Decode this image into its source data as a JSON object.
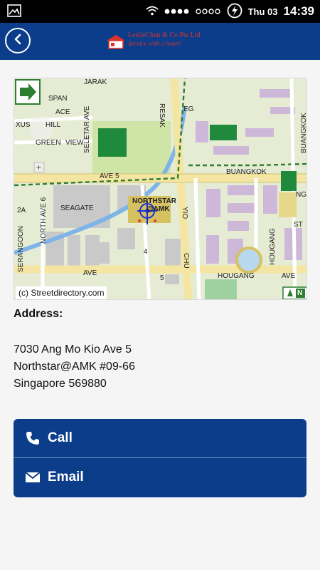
{
  "status_bar": {
    "date": "Thu 03",
    "time": "14:39"
  },
  "header": {
    "brand": "LeslieChan & Co Pte Ltd",
    "tagline": "Service with a heart!"
  },
  "map": {
    "credit": "(c) Streetdirectory.com",
    "labels": {
      "jarak": "JARAK",
      "resak": "RESAK",
      "span": "SPAN",
      "ace": "ACE",
      "xus": "XUS",
      "hill": "HILL",
      "green": "GREEN",
      "view": "VIEW",
      "seletar_ave": "SELETAR AVE",
      "ave5_left": "AVE 5",
      "buangkok_h": "BUANGKOK",
      "buangkok_v": "BUANGKOK",
      "seagate": "SEAGATE",
      "north_ave6": "NORTH AVE 6",
      "serangoon": "SERANGOON",
      "northstar": "NORTHSTAR",
      "amk": "@AMK",
      "two_a": "2A",
      "yio": "YIO",
      "chu": "CHU",
      "four": "4",
      "five": "5",
      "ave_bottom": "AVE",
      "hougang_h": "HOUGANG",
      "hougang_v": "HOUGANG",
      "ave_right": "AVE",
      "st": "ST",
      "n": "N",
      "ng": "NG",
      "eg": "EG"
    }
  },
  "address": {
    "label": "Address:",
    "line1": "7030 Ang Mo Kio Ave 5",
    "line2": "Northstar@AMK #09-66",
    "line3": "Singapore 569880"
  },
  "actions": {
    "call_label": "Call",
    "email_label": "Email"
  },
  "colors": {
    "primary": "#0b3d8a",
    "status_bar": "#000000",
    "background": "#f5f5f5",
    "brand_red": "#d9342b"
  }
}
